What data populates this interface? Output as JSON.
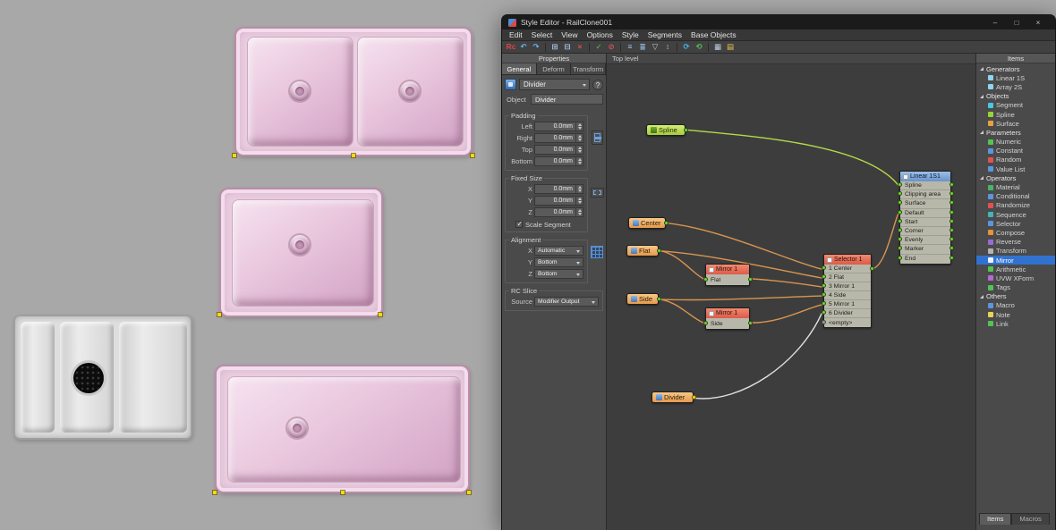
{
  "colors": {
    "wire_green": "#b4d948",
    "wire_orange": "#d9954e",
    "wire_white": "#e0e0e0",
    "selection_blue": "#3272cf",
    "marker_yellow": "#ffd900"
  },
  "window": {
    "title": "Style Editor - RailClone001",
    "controls": [
      {
        "name": "minimize-button",
        "glyph": "–"
      },
      {
        "name": "maximize-button",
        "glyph": "□"
      },
      {
        "name": "close-button",
        "glyph": "×"
      }
    ],
    "menus": [
      {
        "label": "Edit"
      },
      {
        "label": "Select"
      },
      {
        "label": "View"
      },
      {
        "label": "Options"
      },
      {
        "label": "Style"
      },
      {
        "label": "Segments"
      },
      {
        "label": "Base Objects"
      }
    ]
  },
  "toolbar": {
    "icons": [
      {
        "name": "railclone-logo",
        "glyph": "Rc",
        "color": "#e04343"
      },
      {
        "name": "undo-icon",
        "glyph": "↶",
        "color": "#6cb0f0"
      },
      {
        "name": "redo-icon",
        "glyph": "↷",
        "color": "#6cb0f0"
      },
      {
        "name": "separator",
        "type": "sep"
      },
      {
        "name": "copy-icon",
        "glyph": "⊞",
        "color": "#a8c8ec"
      },
      {
        "name": "paste-icon",
        "glyph": "⊟",
        "color": "#a8c8ec"
      },
      {
        "name": "delete-icon",
        "glyph": "×",
        "color": "#e05050"
      },
      {
        "name": "separator",
        "type": "sep"
      },
      {
        "name": "check-style-icon",
        "glyph": "✓",
        "color": "#52c452"
      },
      {
        "name": "discard-icon",
        "glyph": "⊘",
        "color": "#e05050"
      },
      {
        "name": "separator",
        "type": "sep"
      },
      {
        "name": "expand-tree-icon",
        "glyph": "≡",
        "color": "#a0c4ec"
      },
      {
        "name": "list-view-icon",
        "glyph": "≣",
        "color": "#a0c4ec"
      },
      {
        "name": "filter-icon",
        "glyph": "▽",
        "color": "#c8ccd0"
      },
      {
        "name": "arrange-icon",
        "glyph": "↕",
        "color": "#a0c4ec"
      },
      {
        "name": "separator",
        "type": "sep"
      },
      {
        "name": "refresh-icon",
        "glyph": "⟳",
        "color": "#48b4ec"
      },
      {
        "name": "auto-update-icon",
        "glyph": "⟲",
        "color": "#52c452"
      },
      {
        "name": "separator",
        "type": "sep"
      },
      {
        "name": "grid-icon",
        "glyph": "▦",
        "color": "#bccce0"
      },
      {
        "name": "library-icon",
        "glyph": "▤",
        "color": "#e8c454"
      }
    ]
  },
  "properties": {
    "title": "Properties",
    "tabs": [
      {
        "label": "General",
        "state": "active"
      },
      {
        "label": "Deform"
      },
      {
        "label": "Transform"
      }
    ],
    "node_selector": {
      "value": "Divider",
      "help": "?"
    },
    "object_row": {
      "label": "Object",
      "value": "Divider"
    },
    "padding": {
      "title": "Padding",
      "rows": [
        {
          "label": "Left",
          "value": "0.0mm"
        },
        {
          "label": "Right",
          "value": "0.0mm"
        },
        {
          "label": "Top",
          "value": "0.0mm"
        },
        {
          "label": "Bottom",
          "value": "0.0mm"
        }
      ]
    },
    "fixed_size": {
      "title": "Fixed Size",
      "rows": [
        {
          "label": "X",
          "value": "0.0mm"
        },
        {
          "label": "Y",
          "value": "0.0mm"
        },
        {
          "label": "Z",
          "value": "0.0mm"
        }
      ],
      "checkbox": "Scale Segment"
    },
    "alignment": {
      "title": "Alignment",
      "rows": [
        {
          "label": "X",
          "value": "Automatic"
        },
        {
          "label": "Y",
          "value": "Bottom"
        },
        {
          "label": "Z",
          "value": "Bottom"
        }
      ]
    },
    "rc_slice": {
      "title": "RC Slice",
      "label": "Source",
      "value": "Modifier Output"
    }
  },
  "canvas": {
    "label": "Top level",
    "nodes": {
      "spline": {
        "label": "Spline"
      },
      "center": {
        "label": "Center"
      },
      "flat": {
        "label": "Flat"
      },
      "mirror_flat": {
        "title": "Mirror 1",
        "ports": [
          "Flat"
        ]
      },
      "side": {
        "label": "Side"
      },
      "mirror_side": {
        "title": "Mirror 1",
        "ports": [
          "Side"
        ]
      },
      "selector": {
        "title": "Selector 1",
        "ports": [
          "1 Center",
          "2 Flat",
          "3 Mirror 1",
          "4 Side",
          "5 Mirror 1",
          "6 Divider",
          "<empty>"
        ]
      },
      "linear": {
        "title": "Linear 1S1",
        "ports": [
          "Spline",
          "Clipping area",
          "Surface",
          "Default",
          "Start",
          "Corner",
          "Evenly",
          "Marker",
          "End"
        ]
      },
      "divider": {
        "label": "Divider"
      }
    }
  },
  "items_panel": {
    "title": "Items",
    "rows": [
      {
        "label": "Generators",
        "type": "category"
      },
      {
        "label": "Linear 1S",
        "type": "item",
        "icon": "linear-generator-icon",
        "color": "#8fd4f0"
      },
      {
        "label": "Array 2S",
        "type": "item",
        "icon": "array-generator-icon",
        "color": "#8fd4f0"
      },
      {
        "label": "Objects",
        "type": "category"
      },
      {
        "label": "Segment",
        "type": "item",
        "icon": "segment-icon",
        "color": "#46c8e8"
      },
      {
        "label": "Spline",
        "type": "item",
        "icon": "spline-icon",
        "color": "#96d23c"
      },
      {
        "label": "Surface",
        "type": "item",
        "icon": "surface-icon",
        "color": "#e8a23c"
      },
      {
        "label": "Parameters",
        "type": "category"
      },
      {
        "label": "Numeric",
        "type": "item",
        "icon": "numeric-icon",
        "color": "#52c452"
      },
      {
        "label": "Constant",
        "type": "item",
        "icon": "constant-icon",
        "color": "#5a96e0"
      },
      {
        "label": "Random",
        "type": "item",
        "icon": "random-icon",
        "color": "#e05252"
      },
      {
        "label": "Value List",
        "type": "item",
        "icon": "value-list-icon",
        "color": "#5a96e0"
      },
      {
        "label": "Operators",
        "type": "category"
      },
      {
        "label": "Material",
        "type": "item",
        "icon": "material-icon",
        "color": "#46b46a"
      },
      {
        "label": "Conditional",
        "type": "item",
        "icon": "conditional-icon",
        "color": "#5a96e0"
      },
      {
        "label": "Randomize",
        "type": "item",
        "icon": "randomize-icon",
        "color": "#e05252"
      },
      {
        "label": "Sequence",
        "type": "item",
        "icon": "sequence-icon",
        "color": "#46b4b4"
      },
      {
        "label": "Selector",
        "type": "item",
        "icon": "selector-icon",
        "color": "#5a96e0"
      },
      {
        "label": "Compose",
        "type": "item",
        "icon": "compose-icon",
        "color": "#e8923c"
      },
      {
        "label": "Reverse",
        "type": "item",
        "icon": "reverse-icon",
        "color": "#9a6ad4"
      },
      {
        "label": "Transform",
        "type": "item",
        "icon": "transform-icon",
        "color": "#b4b4b4"
      },
      {
        "label": "Mirror",
        "type": "item",
        "icon": "mirror-icon",
        "color": "#eef4ff",
        "state": "selected"
      },
      {
        "label": "Arithmetic",
        "type": "item",
        "icon": "arithmetic-icon",
        "color": "#52c452"
      },
      {
        "label": "UVW XForm",
        "type": "item",
        "icon": "uvw-xform-icon",
        "color": "#b46ad4"
      },
      {
        "label": "Tags",
        "type": "item",
        "icon": "tags-icon",
        "color": "#52c452"
      },
      {
        "label": "Others",
        "type": "category"
      },
      {
        "label": "Macro",
        "type": "item",
        "icon": "macro-icon",
        "color": "#5a96e0"
      },
      {
        "label": "Note",
        "type": "item",
        "icon": "note-icon",
        "color": "#e8d452"
      },
      {
        "label": "Link",
        "type": "item",
        "icon": "link-icon",
        "color": "#52c452"
      }
    ],
    "tabs": [
      {
        "label": "Items",
        "state": "active"
      },
      {
        "label": "Macros"
      }
    ]
  }
}
